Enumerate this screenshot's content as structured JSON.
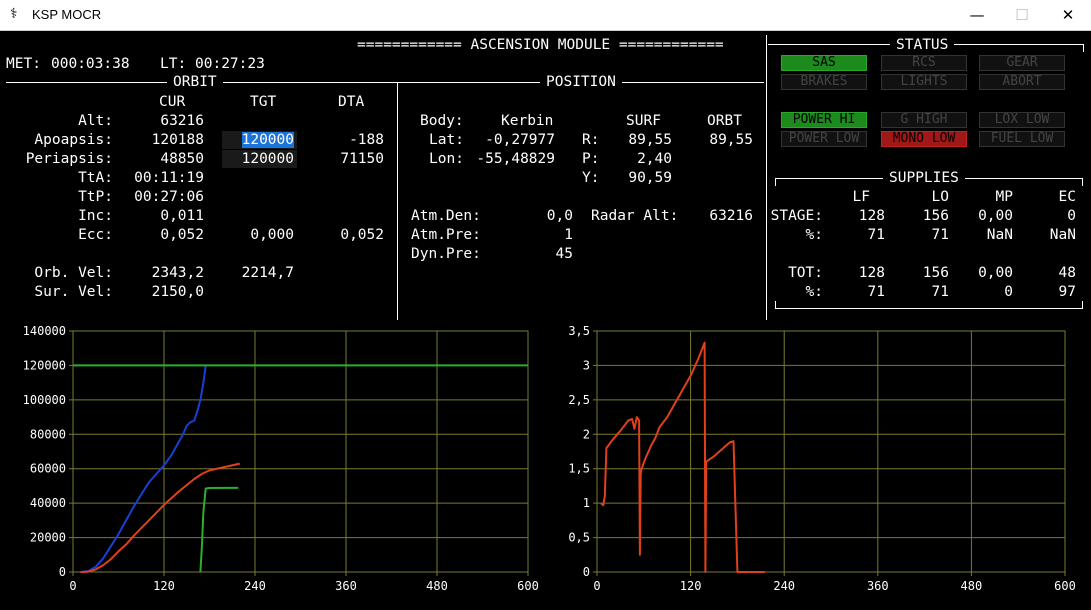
{
  "window": {
    "title": "KSP MOCR",
    "minimize": "—",
    "maximize": "☐",
    "close": "✕"
  },
  "header": {
    "met_label": "MET:",
    "met": "000:03:38",
    "lt_label": "LT:",
    "lt": "00:27:23",
    "module_title": "============ ASCENSION MODULE ============"
  },
  "orbit": {
    "title": "ORBIT",
    "cols": {
      "cur": "CUR",
      "tgt": "TGT",
      "dta": "DTA"
    },
    "rows": [
      {
        "label": "Alt:",
        "cur": "63216",
        "tgt": "",
        "dta": ""
      },
      {
        "label": "Apoapsis:",
        "cur": "120188",
        "tgt": "120000",
        "dta": "-188"
      },
      {
        "label": "Periapsis:",
        "cur": "48850",
        "tgt": "120000",
        "dta": "71150"
      },
      {
        "label": "TtA:",
        "cur": "00:11:19",
        "tgt": "",
        "dta": ""
      },
      {
        "label": "TtP:",
        "cur": "00:27:06",
        "tgt": "",
        "dta": ""
      },
      {
        "label": "Inc:",
        "cur": "0,011",
        "tgt": "",
        "dta": ""
      },
      {
        "label": "Ecc:",
        "cur": "0,052",
        "tgt": "0,000",
        "dta": "0,052"
      }
    ],
    "vel": [
      {
        "label": "Orb. Vel:",
        "cur": "2343,2",
        "tgt": "2214,7"
      },
      {
        "label": "Sur. Vel:",
        "cur": "2150,0",
        "tgt": ""
      }
    ]
  },
  "position": {
    "title": "POSITION",
    "body_label": "Body:",
    "body": "Kerbin",
    "lat_label": "Lat:",
    "lat": "-0,27977",
    "lon_label": "Lon:",
    "lon": "-55,48829",
    "surf_label": "SURF",
    "orbt_label": "ORBT",
    "r_label": "R:",
    "r_surf": "89,55",
    "r_orbt": "89,55",
    "p_label": "P:",
    "p_surf": "2,40",
    "y_label": "Y:",
    "y_surf": "90,59",
    "atm_den_label": "Atm.Den:",
    "atm_den": "0,0",
    "atm_pre_label": "Atm.Pre:",
    "atm_pre": "1",
    "dyn_pre_label": "Dyn.Pre:",
    "dyn_pre": "45",
    "radar_label": "Radar Alt:",
    "radar": "63216"
  },
  "status": {
    "title": "STATUS",
    "indicators": [
      {
        "label": "SAS",
        "state": "green"
      },
      {
        "label": "RCS",
        "state": "off"
      },
      {
        "label": "GEAR",
        "state": "off"
      },
      {
        "label": "BRAKES",
        "state": "off"
      },
      {
        "label": "LIGHTS",
        "state": "off"
      },
      {
        "label": "ABORT",
        "state": "off"
      },
      {
        "label": "POWER HI",
        "state": "green"
      },
      {
        "label": "G HIGH",
        "state": "off"
      },
      {
        "label": "LOX LOW",
        "state": "off"
      },
      {
        "label": "POWER LOW",
        "state": "off"
      },
      {
        "label": "MONO LOW",
        "state": "red"
      },
      {
        "label": "FUEL LOW",
        "state": "off"
      }
    ]
  },
  "supplies": {
    "title": "SUPPLIES",
    "cols": [
      "LF",
      "LO",
      "MP",
      "EC"
    ],
    "rows": [
      {
        "label": "STAGE:",
        "vals": [
          "128",
          "156",
          "0,00",
          "0"
        ]
      },
      {
        "label": "%:",
        "vals": [
          "71",
          "71",
          "NaN",
          "NaN"
        ]
      },
      {
        "label": "TOT:",
        "vals": [
          "128",
          "156",
          "0,00",
          "48"
        ]
      },
      {
        "label": "%:",
        "vals": [
          "71",
          "71",
          "0",
          "97"
        ]
      }
    ]
  },
  "colors": {
    "grid": "#7a7a30",
    "blue": "#1a3fd6",
    "orange": "#e0401a",
    "green": "#2ab02a"
  },
  "chart_data": [
    {
      "type": "line",
      "xlim": [
        0,
        600
      ],
      "ylim": [
        0,
        140000
      ],
      "x_ticks": [
        "0",
        "120",
        "240",
        "360",
        "480",
        "600"
      ],
      "y_ticks": [
        "0",
        "20000",
        "40000",
        "60000",
        "80000",
        "100000",
        "120000",
        "140000"
      ],
      "grid": true,
      "series": [
        {
          "color": "blue",
          "x": [
            10,
            20,
            30,
            40,
            50,
            60,
            70,
            80,
            90,
            100,
            110,
            120,
            130,
            140,
            145,
            150,
            155,
            160,
            165,
            168,
            172,
            175
          ],
          "y": [
            0,
            500,
            3000,
            8000,
            15000,
            22000,
            30000,
            38000,
            45000,
            52000,
            57000,
            62000,
            68000,
            76000,
            80000,
            85000,
            87000,
            88000,
            95000,
            100000,
            110000,
            120000
          ]
        },
        {
          "color": "orange",
          "x": [
            10,
            20,
            30,
            40,
            50,
            60,
            70,
            80,
            100,
            120,
            140,
            160,
            170,
            180,
            200,
            220
          ],
          "y": [
            0,
            200,
            1500,
            4000,
            7500,
            12000,
            16000,
            21000,
            30000,
            39000,
            47000,
            54000,
            57000,
            59000,
            61000,
            63000
          ]
        },
        {
          "color": "green",
          "x": [
            168,
            170,
            172,
            175,
            180,
            200,
            218
          ],
          "y": [
            0,
            15000,
            35000,
            48500,
            48800,
            48850,
            48850
          ]
        },
        {
          "color": "green",
          "x": [
            0,
            600
          ],
          "y": [
            120000,
            120000
          ]
        }
      ]
    },
    {
      "type": "line",
      "xlim": [
        0,
        600
      ],
      "ylim": [
        0,
        3.5
      ],
      "x_ticks": [
        "0",
        "120",
        "240",
        "360",
        "480",
        "600"
      ],
      "y_ticks": [
        "0",
        "0,5",
        "1",
        "1,5",
        "2",
        "2,5",
        "3",
        "3,5"
      ],
      "grid": true,
      "series": [
        {
          "color": "orange",
          "x": [
            5,
            8,
            10,
            12,
            20,
            30,
            40,
            45,
            48,
            51,
            54,
            55,
            56,
            57,
            58,
            62,
            70,
            75,
            80,
            90,
            100,
            110,
            120,
            130,
            138,
            139,
            140,
            142,
            150,
            160,
            170,
            175,
            180,
            200,
            215
          ],
          "y": [
            1,
            0.97,
            1.1,
            1.8,
            1.92,
            2.05,
            2.2,
            2.22,
            2.08,
            2.25,
            2.2,
            0.25,
            1.42,
            1.5,
            1.52,
            1.65,
            1.85,
            1.95,
            2.1,
            2.25,
            2.45,
            2.65,
            2.85,
            3.1,
            3.33,
            0,
            1.6,
            1.62,
            1.68,
            1.78,
            1.88,
            1.9,
            0,
            0,
            0
          ]
        }
      ]
    }
  ]
}
